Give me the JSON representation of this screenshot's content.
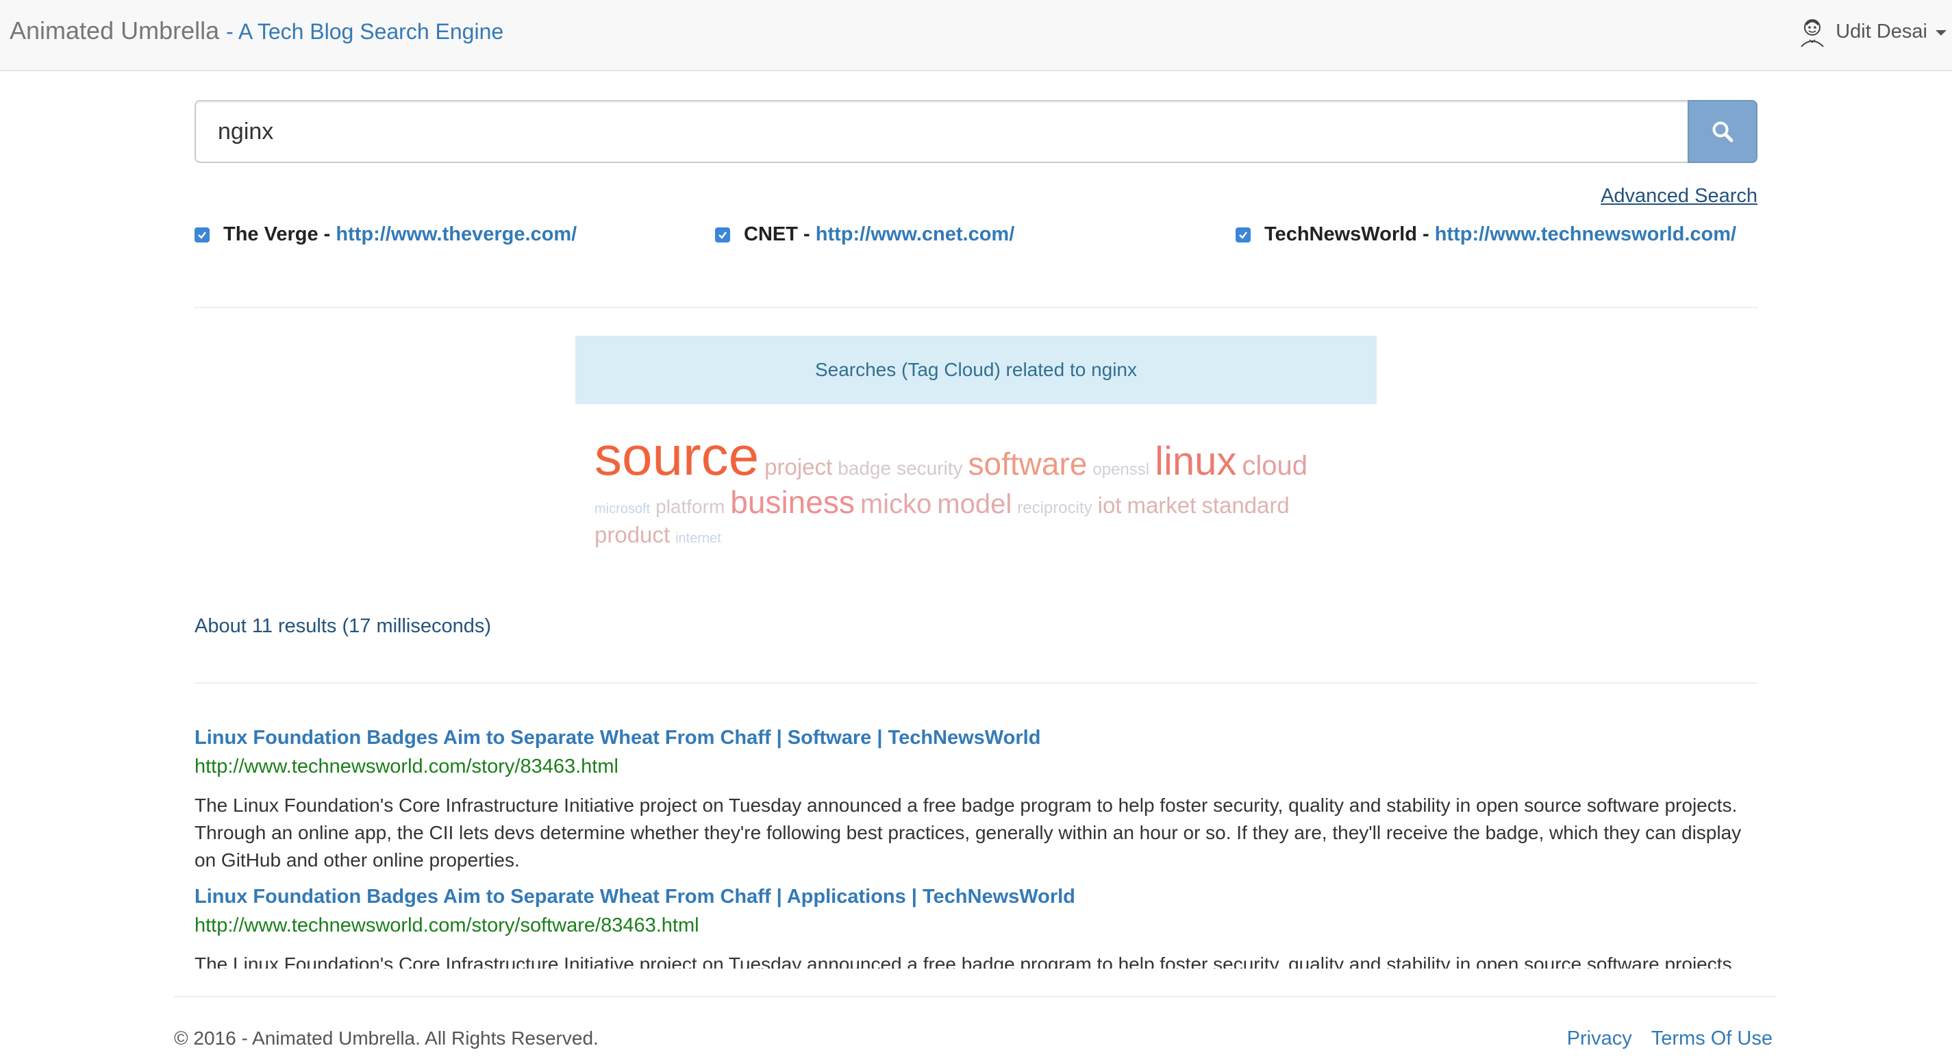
{
  "navbar": {
    "brand": "Animated Umbrella",
    "tagline": "- A Tech Blog Search Engine",
    "user_name": "Udit Desai",
    "user_icon": "avatar-icon",
    "dropdown_icon": "caret-down-icon"
  },
  "search": {
    "value": "nginx",
    "button_icon": "search-icon",
    "advanced_label": "Advanced Search"
  },
  "sources": [
    {
      "name": "The Verge",
      "url": "http://www.theverge.com/",
      "checked": true
    },
    {
      "name": "CNET",
      "url": "http://www.cnet.com/",
      "checked": true
    },
    {
      "name": "TechNewsWorld",
      "url": "http://www.technewsworld.com/",
      "checked": true
    }
  ],
  "source_separator": " - ",
  "tag_cloud": {
    "header": "Searches (Tag Cloud) related to nginx",
    "tags": [
      {
        "text": "source",
        "weight": 10,
        "color": "#f0643c"
      },
      {
        "text": "project",
        "weight": 4,
        "color": "#dfb3b0"
      },
      {
        "text": "badge",
        "weight": 3,
        "color": "#d6c8cb"
      },
      {
        "text": "security",
        "weight": 3,
        "color": "#d6c8cb"
      },
      {
        "text": "software",
        "weight": 6,
        "color": "#ee9a84"
      },
      {
        "text": "openssl",
        "weight": 2,
        "color": "#cfd0d8"
      },
      {
        "text": "linux",
        "weight": 8,
        "color": "#ec7c70"
      },
      {
        "text": "cloud",
        "weight": 5,
        "color": "#e6a0a0"
      },
      {
        "text": "microsoft",
        "weight": 1,
        "color": "#c5d5e8"
      },
      {
        "text": "platform",
        "weight": 3,
        "color": "#d6c8cb"
      },
      {
        "text": "business",
        "weight": 6,
        "color": "#ee9090"
      },
      {
        "text": "micko",
        "weight": 5,
        "color": "#e4aaaa"
      },
      {
        "text": "model",
        "weight": 5,
        "color": "#e4aaaa"
      },
      {
        "text": "reciprocity",
        "weight": 2,
        "color": "#cfd0d8"
      },
      {
        "text": "iot",
        "weight": 4,
        "color": "#dfb3b0"
      },
      {
        "text": "market",
        "weight": 4,
        "color": "#dfb3b0"
      },
      {
        "text": "standard",
        "weight": 4,
        "color": "#dfb3b0"
      },
      {
        "text": "product",
        "weight": 4,
        "color": "#dfb3b0"
      },
      {
        "text": "internet",
        "weight": 1,
        "color": "#c5d5e8"
      }
    ]
  },
  "result_count": "About 11 results (17 milliseconds)",
  "results": [
    {
      "title": "Linux Foundation Badges Aim to Separate Wheat From Chaff | Software | TechNewsWorld",
      "url": "http://www.technewsworld.com/story/83463.html",
      "snippet": "The Linux Foundation's Core Infrastructure Initiative project on Tuesday announced a free badge program to help foster security, quality and stability in open source software projects. Through an online app, the CII lets devs determine whether they're following best practices, generally within an hour or so. If they are, they'll receive the badge, which they can display on GitHub and other online properties."
    },
    {
      "title": "Linux Foundation Badges Aim to Separate Wheat From Chaff | Applications | TechNewsWorld",
      "url": "http://www.technewsworld.com/story/software/83463.html",
      "snippet": "The Linux Foundation's Core Infrastructure Initiative project on Tuesday announced a free badge program to help foster security, quality and stability in open source software projects."
    }
  ],
  "footer": {
    "copyright": "© 2016 - Animated Umbrella. All Rights Reserved.",
    "privacy": "Privacy",
    "terms": "Terms Of Use"
  }
}
